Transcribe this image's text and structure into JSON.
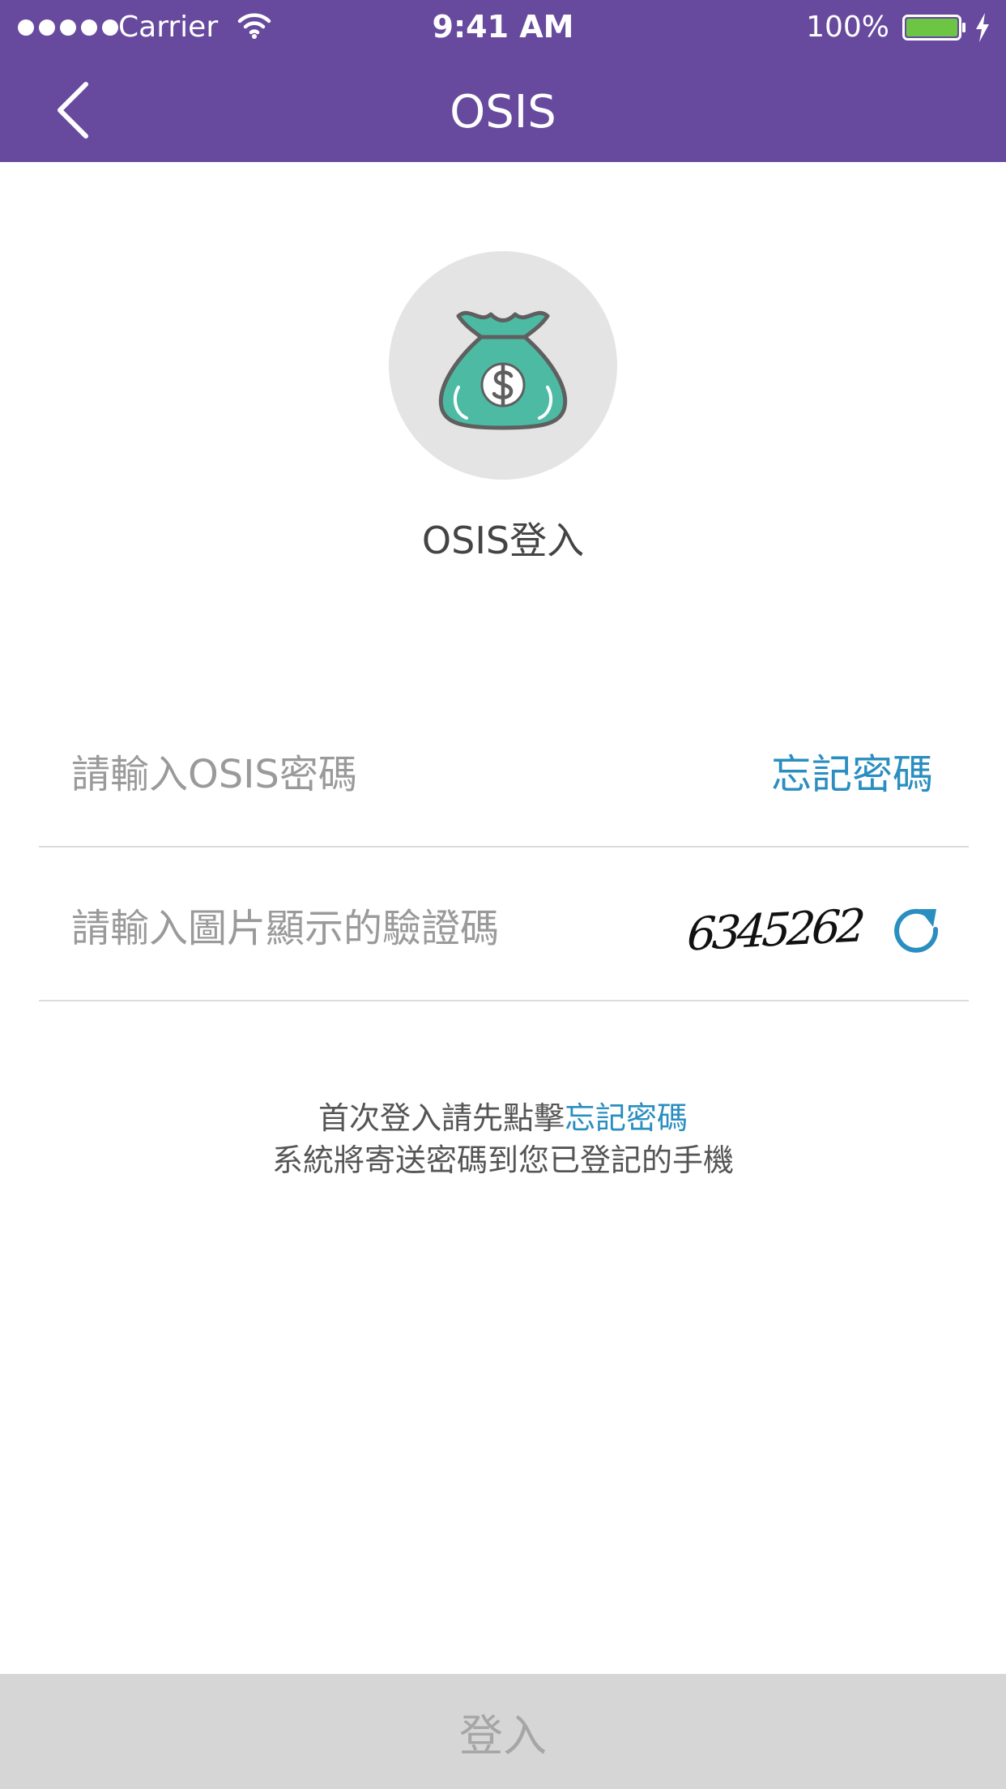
{
  "status_bar": {
    "carrier": "Carrier",
    "time": "9:41 AM",
    "battery_percent": "100%",
    "battery_level": 1.0,
    "signal_bars": 5
  },
  "nav": {
    "title": "OSIS",
    "back_icon": "chevron-left-icon"
  },
  "hero": {
    "icon": "money-bag-icon",
    "heading": "OSIS登入"
  },
  "form": {
    "password": {
      "placeholder": "請輸入OSIS密碼",
      "value": "",
      "forgot_label": "忘記密碼"
    },
    "captcha": {
      "placeholder": "請輸入圖片顯示的驗證碼",
      "value": "",
      "captcha_text": "6345262",
      "refresh_icon": "refresh-icon"
    }
  },
  "hint": {
    "line1_prefix": "首次登入請先點擊",
    "line1_link": "忘記密碼",
    "line2": "系統將寄送密碼到您已登記的手機"
  },
  "submit": {
    "label": "登入"
  },
  "colors": {
    "header_bg": "#674a9e",
    "link": "#2a8ec0",
    "bag_fill": "#4dbba4",
    "battery_fill": "#6cc644",
    "button_disabled_bg": "#d6d6d6",
    "divider": "#dcdcdc"
  }
}
